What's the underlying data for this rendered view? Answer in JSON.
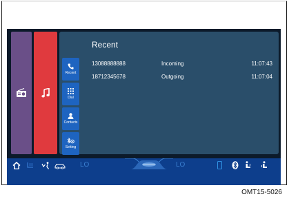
{
  "screen": {
    "tiles": {
      "radio_icon": "radio-icon",
      "music_icon": "music-note-icon"
    },
    "phone": {
      "title": "Recent",
      "tabs": [
        {
          "label": "Recent",
          "icon": "phone-icon"
        },
        {
          "label": "Dial",
          "icon": "keypad-icon"
        },
        {
          "label": "Contacts",
          "icon": "person-icon"
        },
        {
          "label": "Setting",
          "icon": "bluetooth-settings-icon"
        }
      ],
      "calls": [
        {
          "number": "13088888888",
          "type": "Incoming",
          "time": "11:07:43"
        },
        {
          "number": "18712345678",
          "type": "Outgoing",
          "time": "11:07:04"
        }
      ]
    },
    "bottom_bar": {
      "left_temp": "LO",
      "right_temp": "LO"
    }
  },
  "caption": "OMT15-5026",
  "colors": {
    "radio_tile": "#6a4f88",
    "music_tile": "#e03a3e",
    "panel": "#2a4e6a",
    "tab": "#1e64c0",
    "bottom_bar": "#0d3e8c"
  }
}
